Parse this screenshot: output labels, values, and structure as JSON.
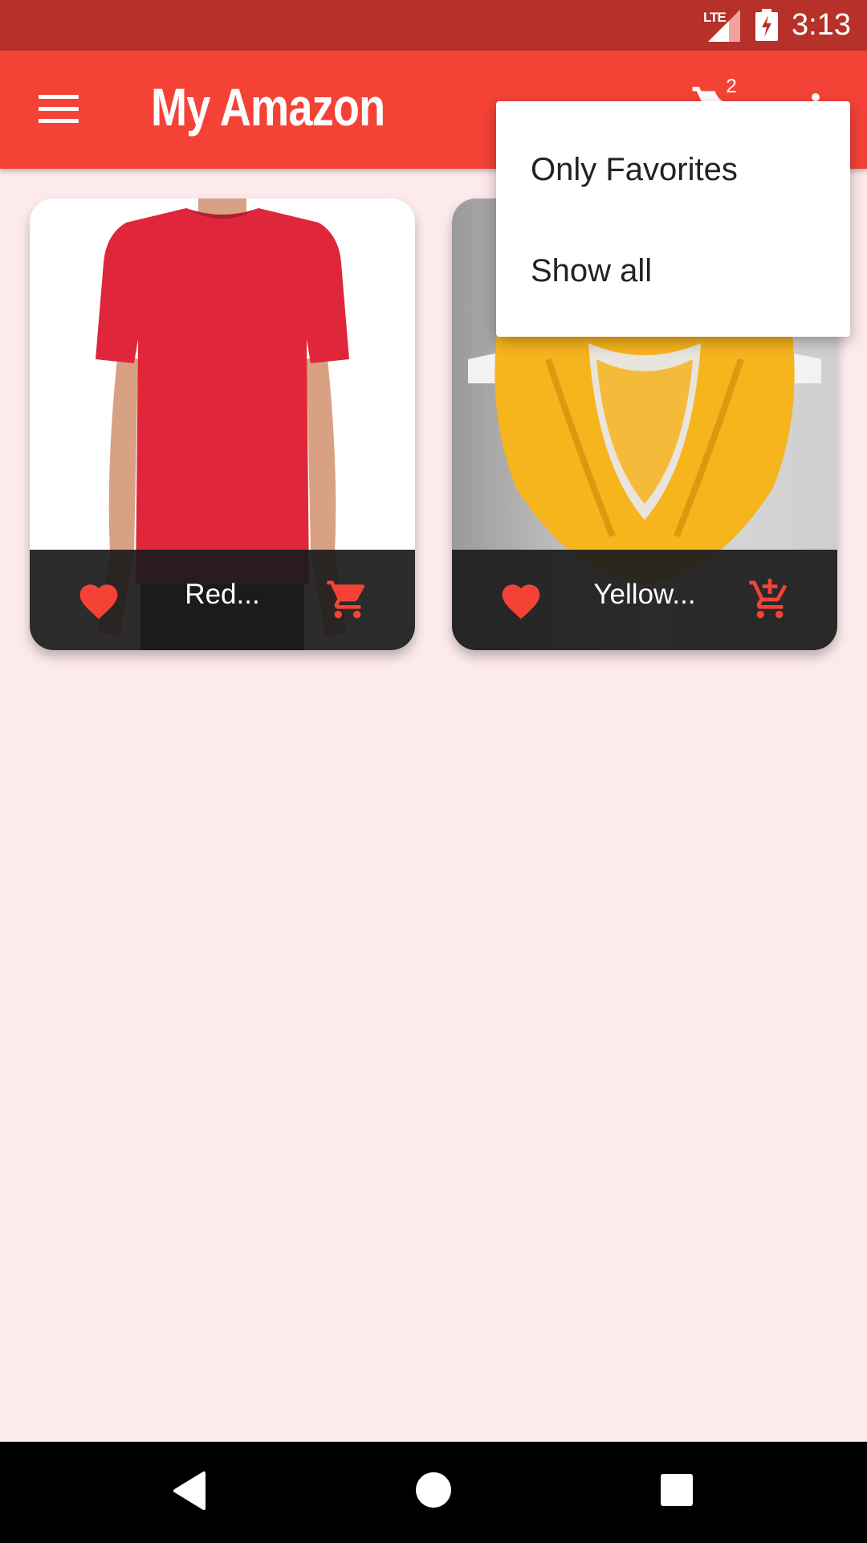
{
  "status_bar": {
    "network": "LTE",
    "time": "3:13"
  },
  "app_bar": {
    "title": "My Amazon",
    "cart_count": "2"
  },
  "products": [
    {
      "title": "Red...",
      "favorite": true,
      "in_cart": true,
      "shirt_color": "#e0263a"
    },
    {
      "title": "Yellow...",
      "favorite": true,
      "in_cart": false,
      "scarf_color": "#f6b41d"
    }
  ],
  "popup_menu": {
    "items": [
      {
        "label": "Only Favorites"
      },
      {
        "label": "Show all"
      }
    ]
  },
  "colors": {
    "primary": "#f44336",
    "status_bar": "#b6312a",
    "background": "#fdeaec",
    "accent_icon": "#f44336"
  },
  "icons": {
    "menu": "menu-icon",
    "cart": "shopping-cart-icon",
    "more": "more-vert-icon",
    "favorite": "heart-icon",
    "add_to_cart": "add-shopping-cart-icon"
  }
}
